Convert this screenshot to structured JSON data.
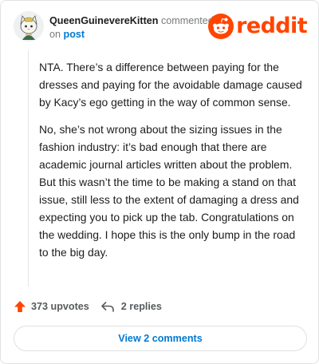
{
  "comment": {
    "username": "QueenGuinevereKitten",
    "action_text": "commented",
    "on_text": "on",
    "post_link": "post",
    "paragraphs": [
      "NTA. There’s a difference between paying for the dresses and paying for the avoidable damage caused by Kacy’s ego getting in the way of common sense.",
      "No, she’s not wrong about the sizing issues in the fashion industry: it’s bad enough that there are academic journal articles written about the problem. But this wasn’t the time to be making a stand on that issue, still less to the extent of damaging a dress and expecting you to pick up the tab. Congratulations on the wedding. I hope this is the only bump in the road to the big day."
    ]
  },
  "brand": {
    "wordmark": "reddit",
    "icon": "reddit-snoo-icon",
    "color": "#ff4500"
  },
  "actions": {
    "upvotes": "373 upvotes",
    "replies": "2 replies",
    "upvote_icon": "upvote-arrow-icon",
    "reply_icon": "reply-arrow-icon",
    "upvote_color": "#ff4500"
  },
  "footer": {
    "view_comments": "View 2 comments",
    "link_color": "#0079d3"
  }
}
